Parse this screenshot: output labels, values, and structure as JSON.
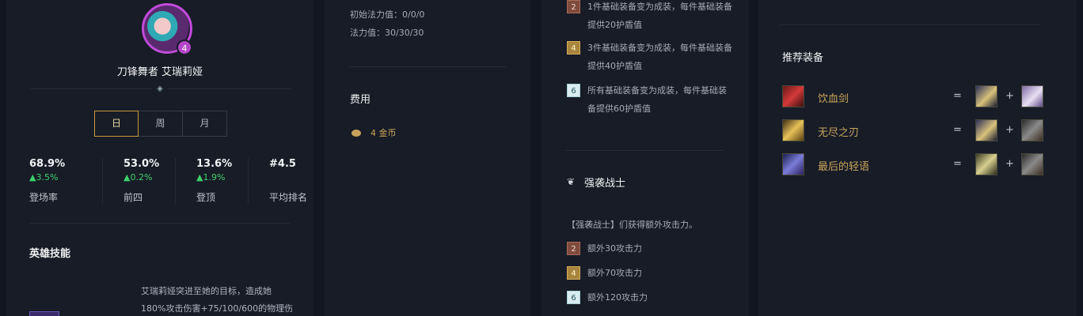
{
  "hero": {
    "name": "刀锋舞者 艾瑞莉娅",
    "cost": "4",
    "tabs": [
      "日",
      "周",
      "月"
    ],
    "active_tab": "日",
    "stats": [
      {
        "value": "68.9%",
        "delta": "▲3.5%",
        "label": "登场率"
      },
      {
        "value": "53.0%",
        "delta": "▲0.2%",
        "label": "前四"
      },
      {
        "value": "13.6%",
        "delta": "▲1.9%",
        "label": "登顶"
      },
      {
        "value": "#4.5",
        "delta": "",
        "label": "平均排名"
      }
    ],
    "skills_title": "英雄技能",
    "skill_text_line1": "艾瑞莉娅突进至她的目标，造成她",
    "skill_text_line2": "180%攻击伤害+75/100/600的物理伤"
  },
  "info": {
    "initial_mana": "初始法力值：0/0/0",
    "mana": "法力值：30/30/30",
    "cost_title": "费用",
    "gold": "4 金币"
  },
  "traits": {
    "top_tiers": [
      {
        "tier": "2",
        "text": "1件基础装备变为成装，每件基础装备提供20护盾值"
      },
      {
        "tier": "4",
        "text": "3件基础装备变为成装，每件基础装备提供40护盾值"
      },
      {
        "tier": "6",
        "text": "所有基础装备变为成装，每件基础装备提供60护盾值"
      }
    ],
    "trait_name": "强袭战士",
    "trait_desc": "【强袭战士】们获得额外攻击力。",
    "tiers": [
      {
        "tier": "2",
        "text": "额外30攻击力"
      },
      {
        "tier": "4",
        "text": "额外70攻击力"
      },
      {
        "tier": "6",
        "text": "额外120攻击力"
      }
    ]
  },
  "items": {
    "title": "推荐装备",
    "list": [
      {
        "name": "饮血剑",
        "icon": "bloodthirster-icon",
        "c1": "bf-sword-icon",
        "c2": "negatron-cloak-icon"
      },
      {
        "name": "无尽之刃",
        "icon": "infinity-edge-icon",
        "c1": "bf-sword-icon",
        "c2": "sparring-gloves-icon"
      },
      {
        "name": "最后的轻语",
        "icon": "last-whisper-icon",
        "c1": "recurve-bow-icon",
        "c2": "sparring-gloves-icon"
      }
    ],
    "eq": "=",
    "plus": "+"
  }
}
